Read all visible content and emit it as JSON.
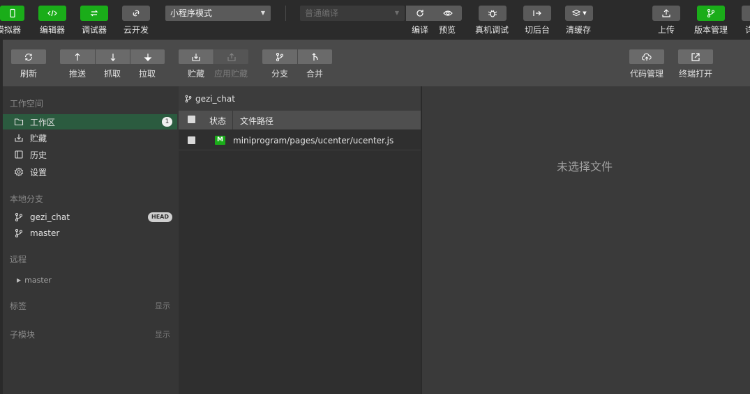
{
  "topbar": {
    "simulator_label": "模拟器",
    "editor_label": "编辑器",
    "debugger_label": "调试器",
    "cloud_label": "云开发",
    "mode_select": "小程序模式",
    "compile_select": "普通编译",
    "compile_label": "编译",
    "preview_label": "预览",
    "device_debug_label": "真机调试",
    "background_label": "切后台",
    "clear_cache_label": "清缓存",
    "upload_label": "上传",
    "version_label": "版本管理",
    "details_label": "详"
  },
  "vcs_toolbar": {
    "refresh": "刷新",
    "push": "推送",
    "fetch": "抓取",
    "pull": "拉取",
    "stash": "贮藏",
    "apply_stash": "应用贮藏",
    "branch": "分支",
    "merge": "合并",
    "code_manage": "代码管理",
    "open_terminal": "终端打开"
  },
  "sidebar": {
    "workspace_title": "工作空间",
    "workspace_items": [
      {
        "label": "工作区",
        "badge": "1"
      },
      {
        "label": "贮藏"
      },
      {
        "label": "历史"
      },
      {
        "label": "设置"
      }
    ],
    "local_branch_title": "本地分支",
    "local_branches": [
      {
        "label": "gezi_chat",
        "badge": "HEAD"
      },
      {
        "label": "master"
      }
    ],
    "remote_title": "远程",
    "remote_items": [
      {
        "label": "master"
      }
    ],
    "tags_title": "标签",
    "tags_show": "显示",
    "submodule_title": "子模块",
    "submodule_show": "显示"
  },
  "filelist": {
    "branch": "gezi_chat",
    "col_status": "状态",
    "col_path": "文件路径",
    "rows": [
      {
        "status": "M",
        "path": "miniprogram/pages/ucenter/ucenter.js"
      }
    ]
  },
  "detail": {
    "empty_text": "未选择文件"
  },
  "colors": {
    "green": "#1aad19",
    "active_bg": "#2b5b3f",
    "modified": "#1aad19"
  }
}
